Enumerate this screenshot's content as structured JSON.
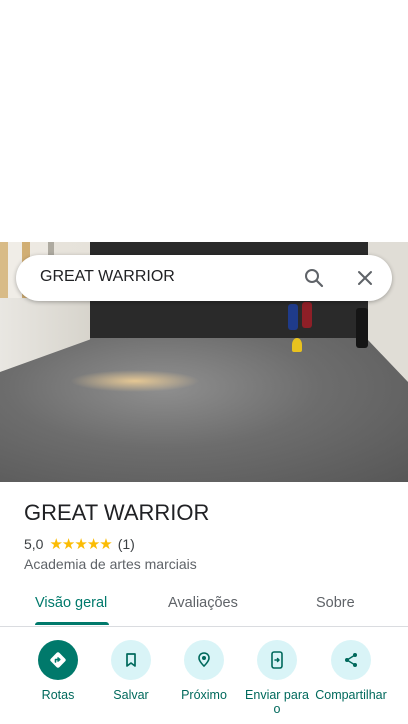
{
  "search": {
    "query": "GREAT WARRIOR"
  },
  "place": {
    "name": "GREAT WARRIOR",
    "rating": "5,0",
    "stars": [
      "★",
      "★",
      "★",
      "★",
      "★"
    ],
    "review_count": "(1)",
    "category": "Academia de artes marciais"
  },
  "tabs": [
    {
      "label": "Visão geral",
      "active": true
    },
    {
      "label": "Avaliações",
      "active": false
    },
    {
      "label": "Sobre",
      "active": false
    }
  ],
  "actions": [
    {
      "label": "Rotas",
      "icon": "directions-icon"
    },
    {
      "label": "Salvar",
      "icon": "bookmark-icon"
    },
    {
      "label": "Próximo",
      "icon": "nearby-icon"
    },
    {
      "label": "Enviar para o",
      "icon": "send-to-phone-icon"
    },
    {
      "label": "Compartilhar",
      "icon": "share-icon"
    }
  ],
  "colors": {
    "accent": "#00796b",
    "action_bg": "#d9f4f7",
    "star": "#fbbc04"
  }
}
